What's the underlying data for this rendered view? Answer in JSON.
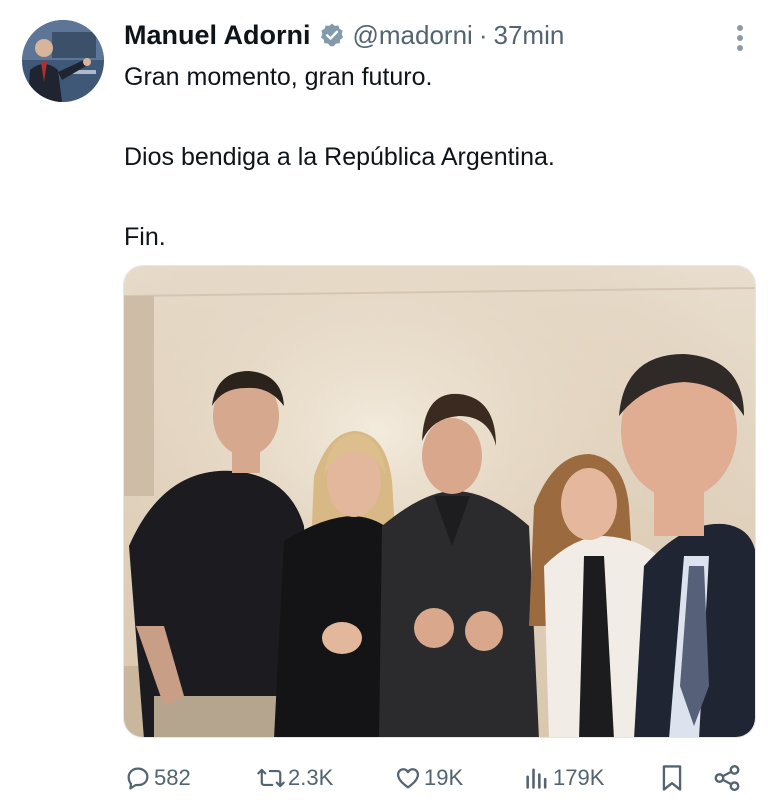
{
  "author": {
    "name": "Manuel Adorni",
    "handle": "@madorni",
    "separator": "·",
    "time": "37min",
    "verified_color": "#536471"
  },
  "tweet": {
    "lines": [
      "Gran momento, gran futuro.",
      "Dios bendiga a la República Argentina.",
      "Fin."
    ]
  },
  "media": {
    "alt": "Five people posing together indoors, several giving thumbs up"
  },
  "actions": {
    "reply_count": "582",
    "retweet_count": "2.3K",
    "like_count": "19K",
    "views_count": "179K"
  },
  "icons": {
    "reply": "reply-icon",
    "retweet": "retweet-icon",
    "like": "heart-icon",
    "views": "views-icon",
    "bookmark": "bookmark-icon",
    "share": "share-icon",
    "more": "more-vertical-icon"
  },
  "colors": {
    "text": "#0f1419",
    "secondary": "#536471"
  }
}
